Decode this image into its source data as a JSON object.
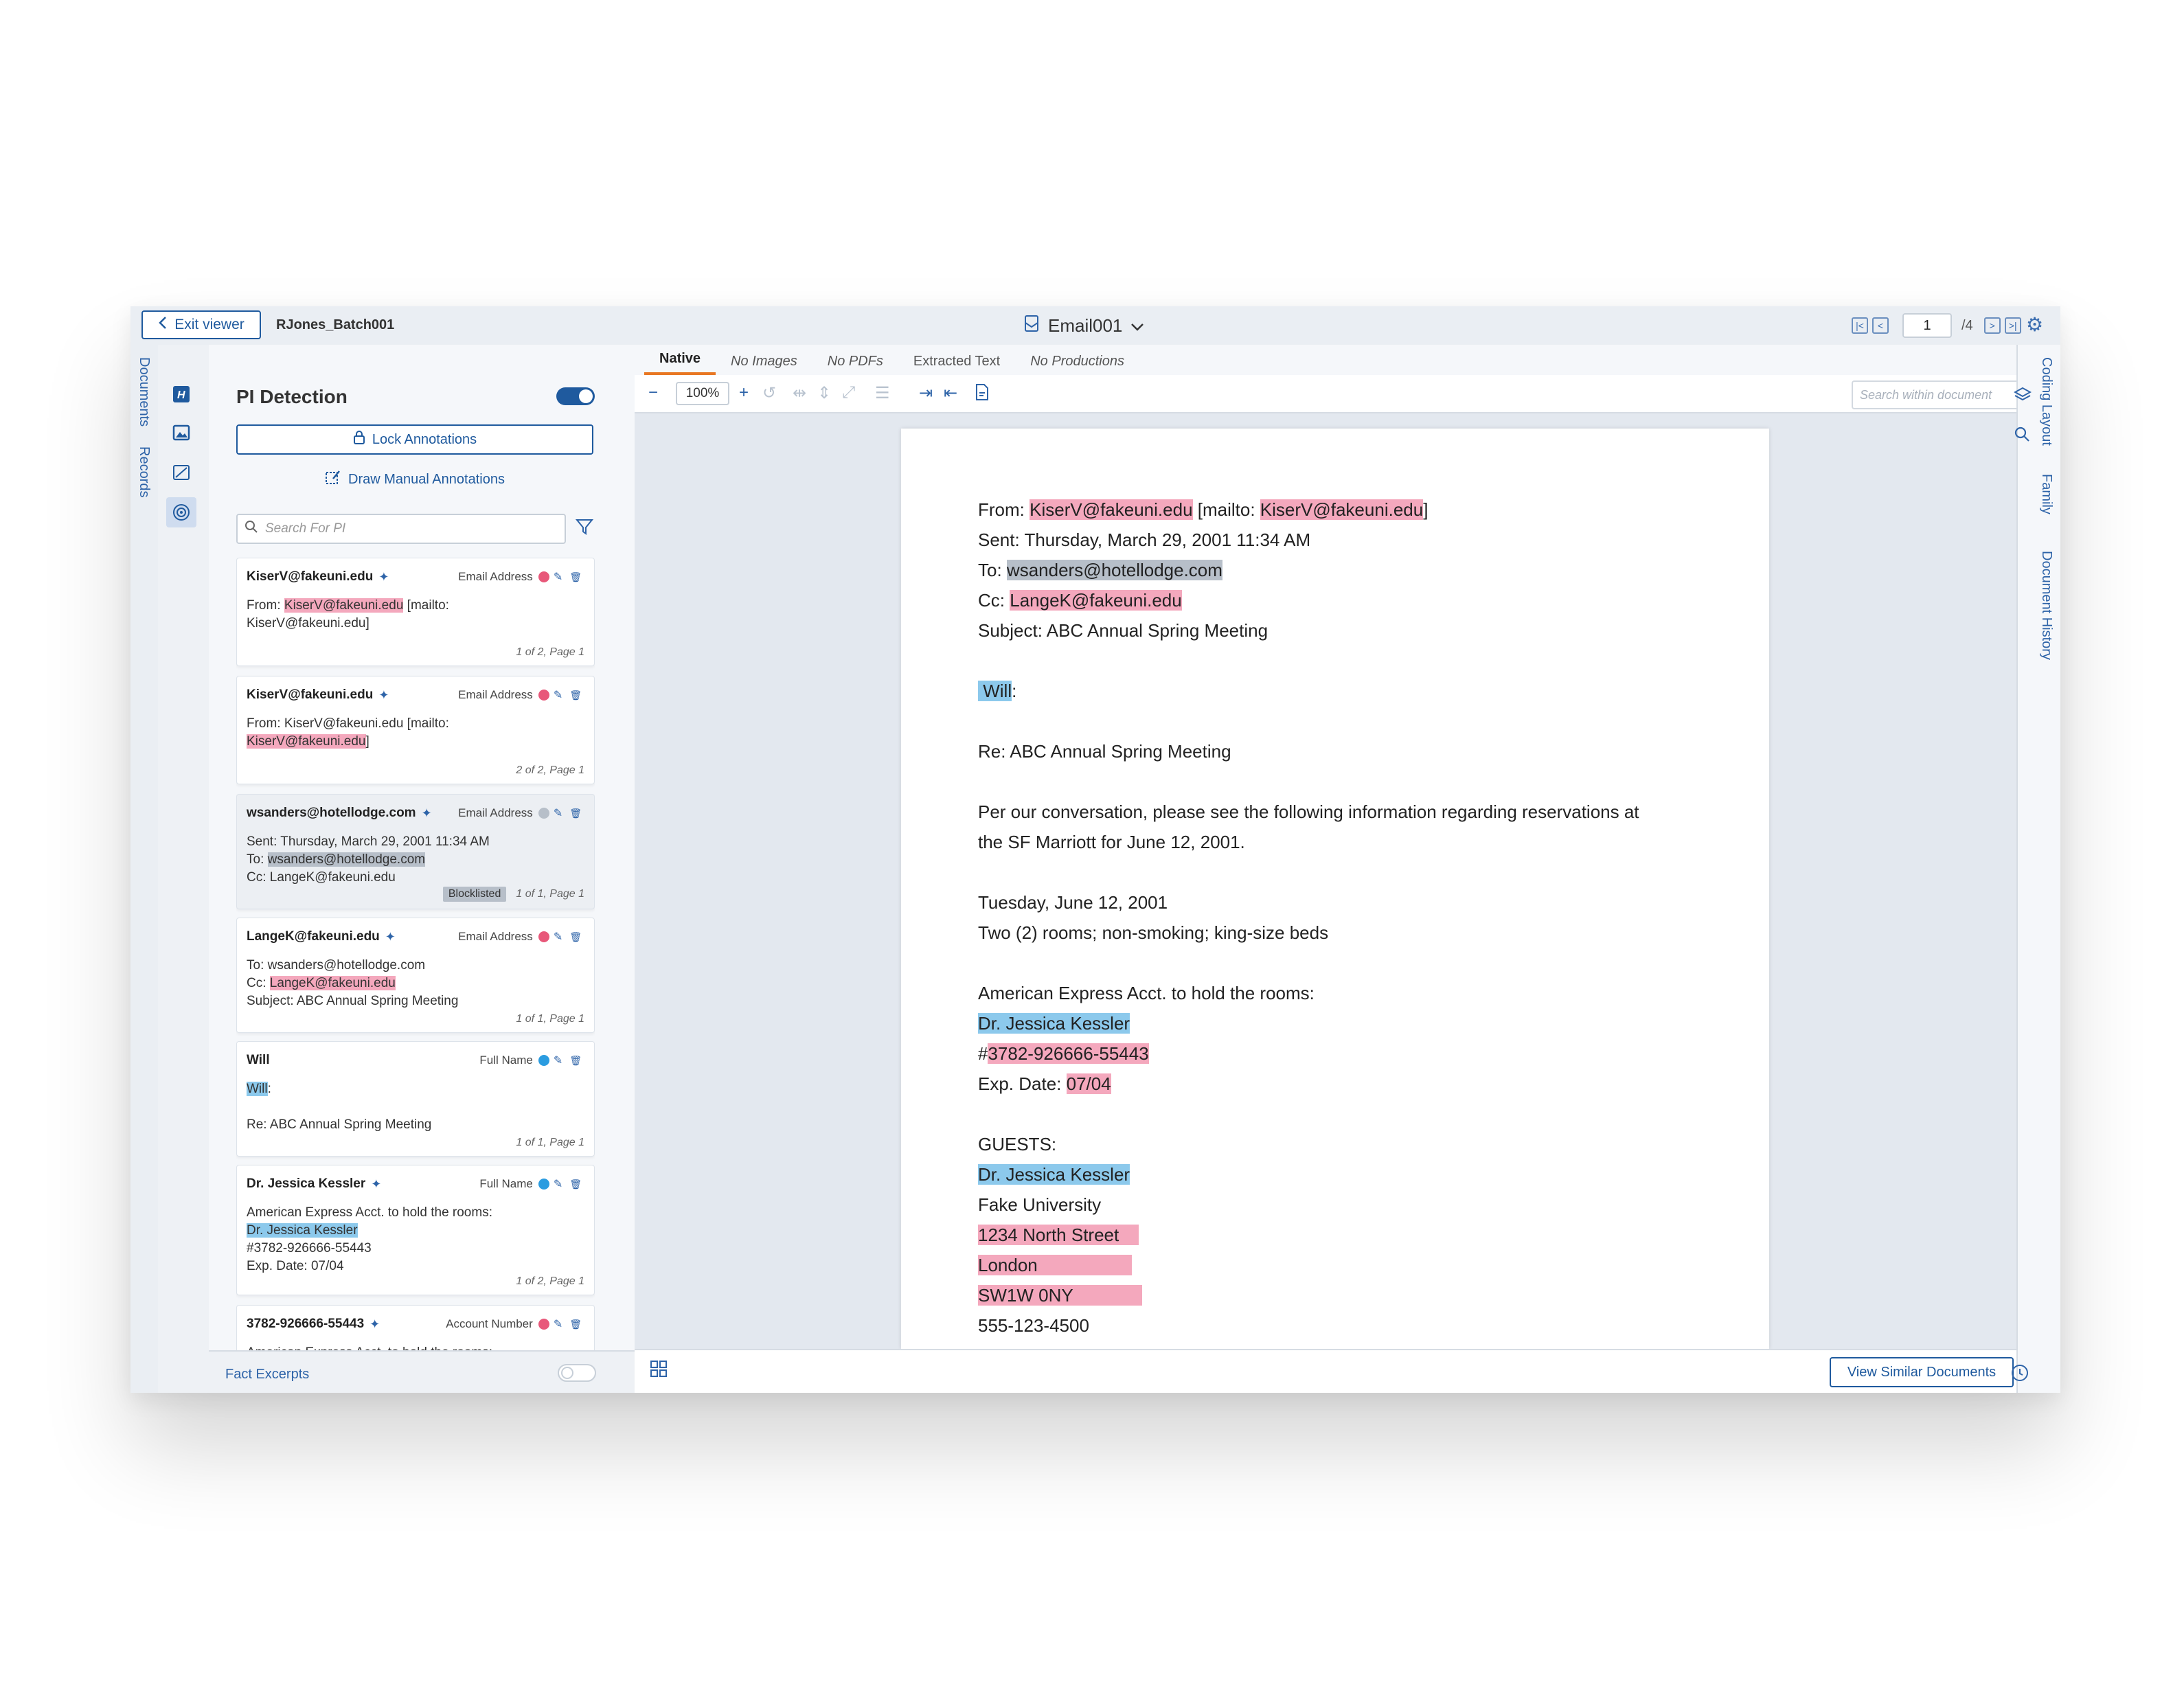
{
  "header": {
    "exit_label": "Exit viewer",
    "batch": "RJones_Batch001",
    "doc_title": "Email001",
    "page_current": "1",
    "page_total": "/4"
  },
  "left_rail": {
    "documents": "Documents",
    "records": "Records"
  },
  "pi_panel": {
    "title": "PI Detection",
    "lock_label": "Lock Annotations",
    "draw_label": "Draw Manual Annotations",
    "search_placeholder": "Search For PI",
    "fact_excerpts": "Fact Excerpts",
    "cards": [
      {
        "title": "KiserV@fakeuni.edu",
        "type": "Email Address",
        "color": "#e8587a",
        "lines": [
          [
            "From: ",
            {
              "t": "KiserV@fakeuni.edu",
              "h": "p"
            },
            " [mailto:"
          ],
          [
            "KiserV@fakeuni.edu]"
          ]
        ],
        "footer": "1 of 2, Page 1"
      },
      {
        "title": "KiserV@fakeuni.edu",
        "type": "Email Address",
        "color": "#e8587a",
        "lines": [
          [
            "From: KiserV@fakeuni.edu [mailto:"
          ],
          [
            {
              "t": "KiserV@fakeuni.edu",
              "h": "p"
            },
            "]"
          ]
        ],
        "footer": "2 of 2, Page 1"
      },
      {
        "title": "wsanders@hotellodge.com",
        "type": "Email Address",
        "color": "#b7bfc9",
        "dim": true,
        "lines": [
          [
            "Sent: Thursday, March 29, 2001 11:34 AM"
          ],
          [
            "To: ",
            {
              "t": "wsanders@hotellodge.com",
              "h": "g"
            }
          ],
          [
            "Cc: LangeK@fakeuni.edu"
          ]
        ],
        "badge": "Blocklisted",
        "footer": "1 of 1, Page 1"
      },
      {
        "title": "LangeK@fakeuni.edu",
        "type": "Email Address",
        "color": "#e8587a",
        "lines": [
          [
            "To: wsanders@hotellodge.com"
          ],
          [
            "Cc: ",
            {
              "t": "LangeK@fakeuni.edu",
              "h": "p"
            }
          ],
          [
            "Subject: ABC Annual Spring Meeting"
          ]
        ],
        "footer": "1 of 1, Page 1"
      },
      {
        "title": "Will",
        "type": "Full Name",
        "color": "#2b9ce0",
        "nospark": true,
        "lines": [
          [
            {
              "t": "Will",
              "h": "b"
            },
            ":"
          ],
          [
            ""
          ],
          [
            "Re: ABC Annual Spring Meeting"
          ]
        ],
        "footer": "1 of 1, Page 1"
      },
      {
        "title": "Dr. Jessica Kessler",
        "type": "Full Name",
        "color": "#2b9ce0",
        "lines": [
          [
            "American Express Acct. to hold the rooms:"
          ],
          [
            {
              "t": "Dr. Jessica Kessler",
              "h": "b"
            }
          ],
          [
            "#3782-926666-55443"
          ],
          [
            "Exp. Date: 07/04"
          ]
        ],
        "footer": "1 of 2, Page 1"
      },
      {
        "title": "3782-926666-55443",
        "type": "Account Number",
        "color": "#e8587a",
        "lines": [
          [
            "American Express Acct. to hold the rooms:"
          ]
        ],
        "footer": ""
      }
    ]
  },
  "viewer": {
    "tabs": [
      "Native",
      "No Images",
      "No PDFs",
      "Extracted Text",
      "No Productions"
    ],
    "zoom": "100%",
    "search_placeholder": "Search within document",
    "similar_label": "View Similar Documents",
    "lines": [
      [
        {
          "t": "From: "
        },
        {
          "t": "KiserV@fakeuni.edu",
          "h": "p"
        },
        {
          "t": " [mailto: "
        },
        {
          "t": "KiserV@fakeuni.edu",
          "h": "p"
        },
        {
          "t": "]"
        }
      ],
      [
        {
          "t": "Sent: Thursday, March 29, 2001 11:34 AM"
        }
      ],
      [
        {
          "t": "To: "
        },
        {
          "t": "wsanders@hotellodge.com",
          "h": "g"
        }
      ],
      [
        {
          "t": "Cc: "
        },
        {
          "t": "LangeK@fakeuni.edu",
          "h": "p"
        }
      ],
      [
        {
          "t": "Subject: ABC Annual Spring Meeting"
        }
      ],
      [],
      [
        {
          "t": " Will",
          "h": "b"
        },
        {
          "t": ":"
        }
      ],
      [],
      [
        {
          "t": "Re: ABC Annual Spring Meeting"
        }
      ],
      [],
      [
        {
          "t": "Per our conversation, please see the following information regarding reservations at"
        }
      ],
      [
        {
          "t": "the SF Marriott for June 12, 2001."
        }
      ],
      [],
      [
        {
          "t": "Tuesday, June 12, 2001"
        }
      ],
      [
        {
          "t": "Two (2) rooms; non-smoking; king-size beds"
        }
      ],
      [],
      [
        {
          "t": "American Express Acct. to hold the rooms:"
        }
      ],
      [
        {
          "t": "Dr. Jessica Kessler",
          "h": "b"
        }
      ],
      [
        {
          "t": "#"
        },
        {
          "t": "3782-926666-55443",
          "h": "p"
        }
      ],
      [
        {
          "t": "Exp. Date: "
        },
        {
          "t": "07/04",
          "h": "p"
        }
      ],
      [],
      [
        {
          "t": "GUESTS:"
        }
      ],
      [
        {
          "t": "Dr. Jessica Kessler",
          "h": "b"
        }
      ],
      [
        {
          "t": "Fake University"
        }
      ],
      [
        {
          "t": "1234 North Street    ",
          "h": "p"
        }
      ],
      [
        {
          "t": "London                   ",
          "h": "p"
        }
      ],
      [
        {
          "t": "SW1W 0NY              ",
          "h": "p"
        }
      ],
      [
        {
          "t": "555-123-4500"
        }
      ]
    ]
  },
  "right_rail": {
    "coding": "Coding Layout",
    "family": "Family",
    "history": "Document History"
  }
}
